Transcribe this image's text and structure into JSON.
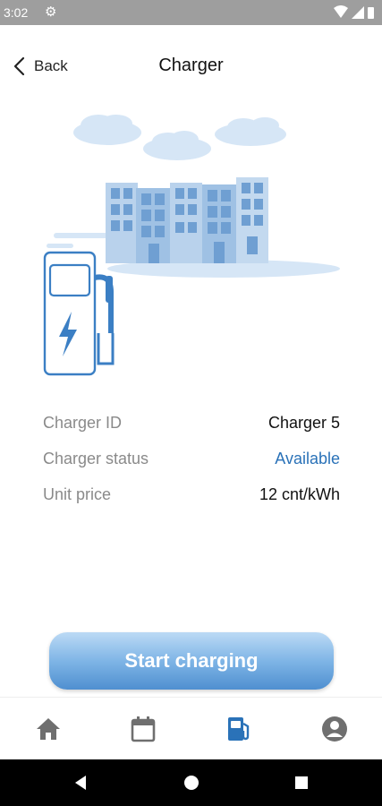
{
  "status_bar": {
    "time": "3:02",
    "icons": [
      "gear-icon",
      "wifi-icon",
      "signal-icon",
      "battery-icon"
    ]
  },
  "header": {
    "back_label": "Back",
    "title": "Charger"
  },
  "charger": {
    "rows": [
      {
        "label": "Charger ID",
        "value": "Charger 5"
      },
      {
        "label": "Charger status",
        "value": "Available"
      },
      {
        "label": "Unit price",
        "value": "12 cnt/kWh"
      }
    ]
  },
  "actions": {
    "start_label": "Start charging"
  },
  "bottom_nav": {
    "items": [
      "home-icon",
      "calendar-icon",
      "fuel-station-icon",
      "account-icon"
    ],
    "active": "fuel-station-icon"
  },
  "colors": {
    "accent": "#2a72b8",
    "button_top": "#bcdaf5",
    "button_bottom": "#4f8fd0",
    "muted": "#8a8a8a",
    "nav_inactive": "#6f6f6f"
  }
}
